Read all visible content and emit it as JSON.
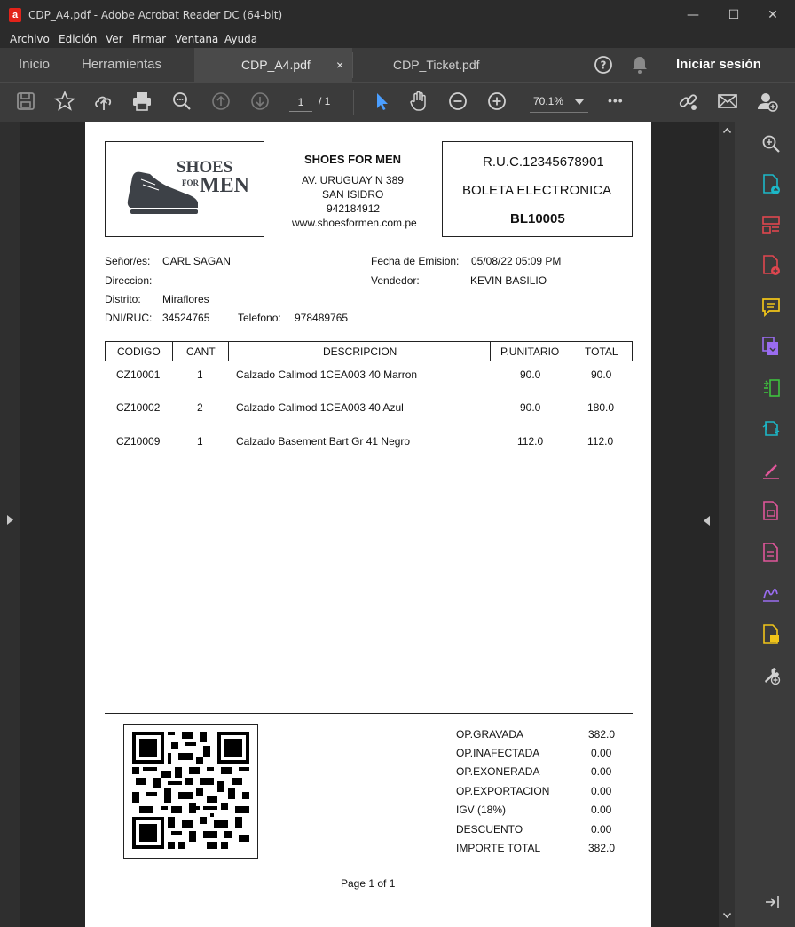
{
  "window": {
    "title": "CDP_A4.pdf - Adobe Acrobat Reader DC (64-bit)",
    "minimize": "—",
    "maximize": "☐",
    "close": "✕"
  },
  "menu": [
    "Archivo",
    "Edición",
    "Ver",
    "Firmar",
    "Ventana",
    "Ayuda"
  ],
  "tabs": {
    "home": "Inicio",
    "tools": "Herramientas",
    "doc1": "CDP_A4.pdf",
    "doc1_close": "×",
    "doc2": "CDP_Ticket.pdf",
    "signin": "Iniciar sesión"
  },
  "toolbar": {
    "page_current": "1",
    "page_total": "/ 1",
    "zoom": "70.1%",
    "more": "•••"
  },
  "colors": {
    "accent": "#4a9eff",
    "rail_green": "#3ec13e",
    "rail_red": "#e0464f",
    "rail_yellow": "#f0c419",
    "rail_pink": "#e0569a",
    "rail_purple": "#9a6cf0",
    "rail_cyan": "#1cb8c8"
  },
  "document": {
    "logo": {
      "line1": "SHOES",
      "line2": "FOR",
      "line3": "MEN"
    },
    "company": {
      "name": "SHOES FOR MEN",
      "address": "AV. URUGUAY N 389",
      "district": "SAN ISIDRO",
      "phone": "942184912",
      "web": "www.shoesformen.com.pe"
    },
    "ruc_box": {
      "ruc": "R.U.C.12345678901",
      "type": "BOLETA ELECTRONICA",
      "number": "BL10005"
    },
    "client": {
      "senor_label": "Señor/es:",
      "senor_value": "CARL SAGAN",
      "direccion_label": "Direccion:",
      "distrito_label": "Distrito:",
      "distrito_value": "Miraflores",
      "dni_label": "DNI/RUC:",
      "dni_value": "34524765",
      "telefono_label": "Telefono:",
      "telefono_value": "978489765",
      "fecha_label": "Fecha de Emision:",
      "fecha_value": "05/08/22 05:09 PM",
      "vendedor_label": "Vendedor:",
      "vendedor_value": "KEVIN BASILIO"
    },
    "table": {
      "headers": [
        "CODIGO",
        "CANT",
        "DESCRIPCION",
        "P.UNITARIO",
        "TOTAL"
      ],
      "rows": [
        [
          "CZ10001",
          "1",
          "Calzado Calimod 1CEA003 40 Marron",
          "90.0",
          "90.0"
        ],
        [
          "CZ10002",
          "2",
          "Calzado Calimod 1CEA003 40 Azul",
          "90.0",
          "180.0"
        ],
        [
          "CZ10009",
          "1",
          "Calzado Basement Bart Gr 41 Negro",
          "112.0",
          "112.0"
        ]
      ]
    },
    "totals": [
      {
        "label": "OP.GRAVADA",
        "value": "382.0"
      },
      {
        "label": "OP.INAFECTADA",
        "value": "0.00"
      },
      {
        "label": "OP.EXONERADA",
        "value": "0.00"
      },
      {
        "label": "OP.EXPORTACION",
        "value": "0.00"
      },
      {
        "label": "IGV (18%)",
        "value": "0.00"
      },
      {
        "label": "DESCUENTO",
        "value": "0.00"
      },
      {
        "label": "IMPORTE TOTAL",
        "value": "382.0"
      }
    ],
    "footer": "Page 1 of 1"
  }
}
